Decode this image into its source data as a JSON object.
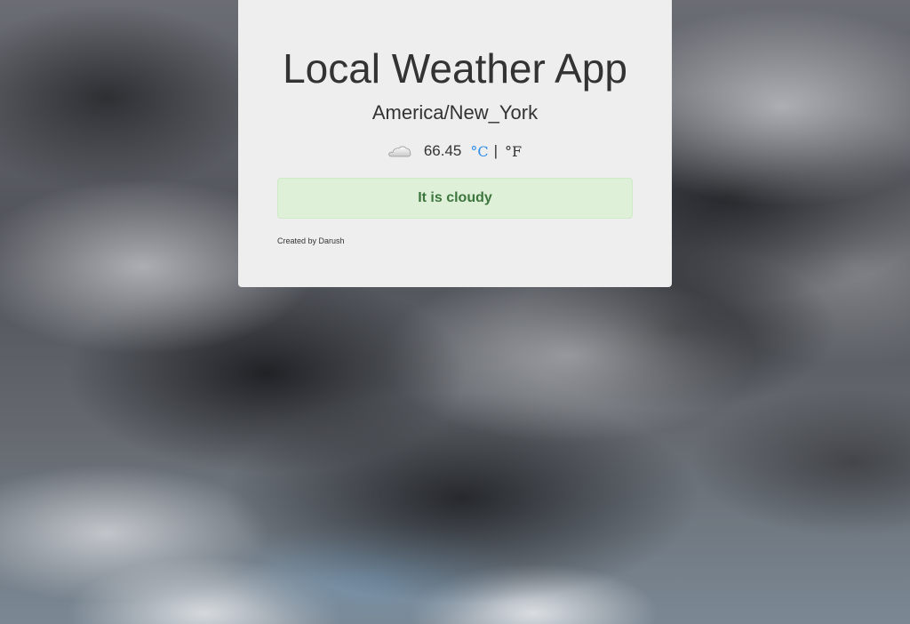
{
  "app": {
    "title": "Local Weather App",
    "location": "America/New_York"
  },
  "weather": {
    "icon": "cloud-icon",
    "temperature": "66.45",
    "unit_celsius": "°C",
    "separator": "|",
    "unit_fahrenheit": "°F",
    "status": "It is cloudy"
  },
  "footer": {
    "credit": "Created by Darush"
  },
  "colors": {
    "card_background": "#eeeeee",
    "status_background": "#dff0d8",
    "status_text": "#3c763d",
    "celsius_link": "#2f8ee8"
  }
}
